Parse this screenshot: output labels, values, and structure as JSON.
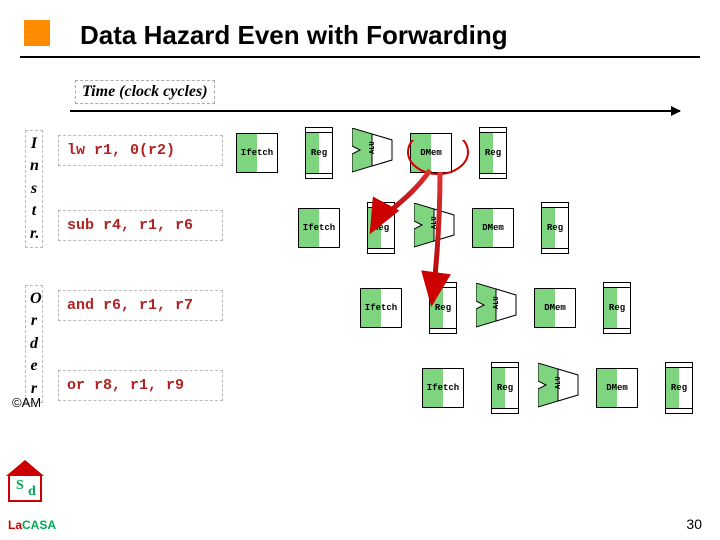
{
  "title": "Data Hazard Even with Forwarding",
  "time_label": "Time (clock cycles)",
  "left_labels": {
    "instr": [
      "I",
      "n",
      "s",
      "t",
      "r."
    ],
    "order": [
      "O",
      "r",
      "d",
      "e",
      "r"
    ]
  },
  "instructions": [
    "lw r1, 0(r2)",
    "sub r4, r1, r6",
    "and r6, r1, r7",
    "or  r8, r1, r9"
  ],
  "stage_labels": {
    "ifetch": "Ifetch",
    "reg": "Reg",
    "alu": "ALU",
    "dmem": "DMem"
  },
  "footer": {
    "copyright": "©AM",
    "lacasa_la": "La",
    "lacasa_casa": "CASA",
    "page": "30"
  }
}
